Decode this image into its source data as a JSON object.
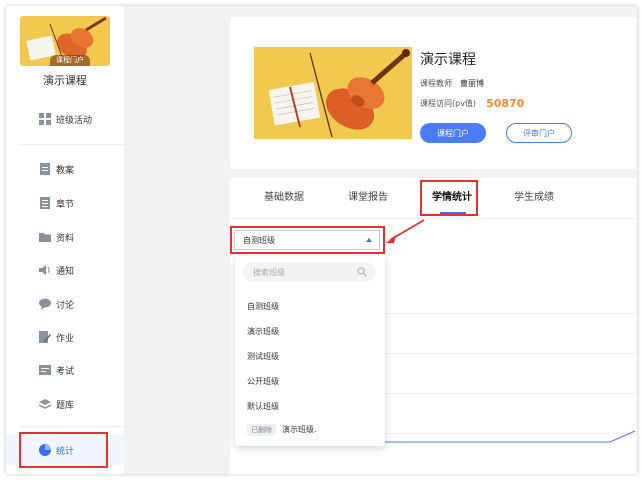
{
  "sidebar": {
    "portal_tag": "课程门户",
    "course_name": "演示课程",
    "items": [
      {
        "label": "班级活动",
        "icon": "grid-icon"
      },
      {
        "label": "教案",
        "icon": "doc-icon"
      },
      {
        "label": "章节",
        "icon": "list-icon"
      },
      {
        "label": "资料",
        "icon": "folder-icon"
      },
      {
        "label": "通知",
        "icon": "speaker-icon"
      },
      {
        "label": "讨论",
        "icon": "chat-icon"
      },
      {
        "label": "作业",
        "icon": "edit-icon"
      },
      {
        "label": "考试",
        "icon": "exam-icon"
      },
      {
        "label": "题库",
        "icon": "layers-icon"
      },
      {
        "label": "统计",
        "icon": "pie-icon"
      }
    ]
  },
  "header": {
    "title": "演示课程",
    "teacher_label": "课程教师",
    "teacher_name": "曹丽博",
    "visits_label": "课程访问(pv值)",
    "visits_value": "50870",
    "portal_button": "课程门户",
    "review_button": "评审门户"
  },
  "tabs": [
    {
      "label": "基础数据"
    },
    {
      "label": "课堂报告"
    },
    {
      "label": "学情统计"
    },
    {
      "label": "学生成绩"
    }
  ],
  "class_select": {
    "value": "自测班级",
    "search_placeholder": "搜索班级",
    "options": [
      "自测班级",
      "演示班级",
      "测试班级",
      "公开班级",
      "默认班级"
    ],
    "deleted_tag": "已删除",
    "deleted_option": "演示班级."
  },
  "colors": {
    "accent": "#3a6df0",
    "highlight": "#e8302e",
    "visits": "#ff8a2b"
  }
}
